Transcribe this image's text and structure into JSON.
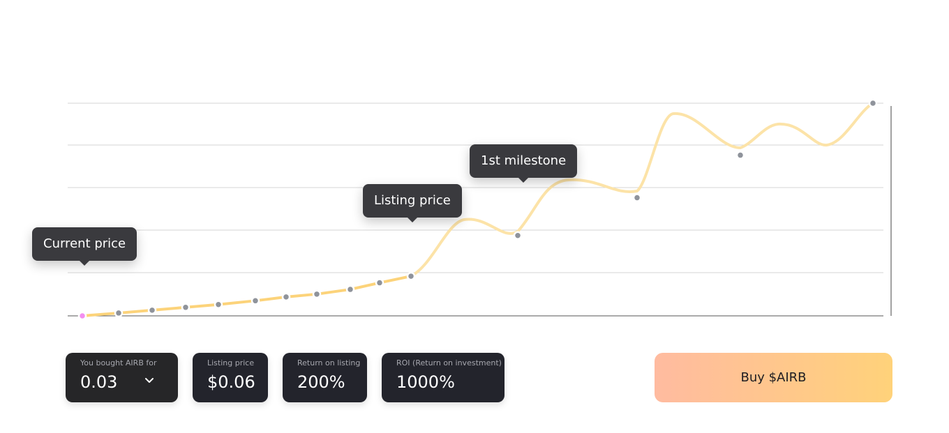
{
  "chart_data": {
    "type": "line",
    "series": [
      {
        "values": [
          0.03,
          0.033,
          0.036,
          0.039,
          0.042,
          0.046,
          0.05,
          0.053,
          0.058,
          0.065,
          0.072,
          0.115,
          0.155,
          0.2,
          0.255
        ]
      }
    ],
    "points_x": [
      0,
      1,
      2,
      3,
      4,
      5,
      6,
      7,
      8,
      9,
      10,
      11,
      12,
      13,
      14
    ],
    "ylim": [
      0.03,
      0.255
    ],
    "grid": true,
    "highlight_colors": {
      "line": "#fcd37a",
      "line_faded": "#fde7b6",
      "current_point": "#f38ef0",
      "point": "#8f939b",
      "grid": "#d6d6d6"
    }
  },
  "annotations": {
    "current": "Current price",
    "listing": "Listing price",
    "milestone": "1st milestone"
  },
  "cards": {
    "bought": {
      "label": "You bought AIRB for",
      "value": "0.03"
    },
    "listing": {
      "label": "Listing price",
      "value": "$0.06"
    },
    "return_listing": {
      "label": "Return on listing",
      "value": "200%"
    },
    "roi": {
      "label": "ROI (Return on investment)",
      "value": "1000%"
    }
  },
  "buy_button": {
    "label": "Buy $AIRB"
  },
  "icons": {
    "dropdown": "chevron-down-icon"
  }
}
